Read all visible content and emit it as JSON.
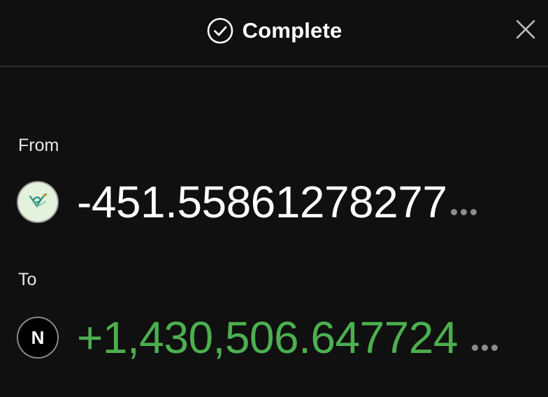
{
  "header": {
    "title": "Complete",
    "status_icon": "check-circle-icon",
    "close_icon": "close-icon"
  },
  "from": {
    "label": "From",
    "amount": "-451.55861278277",
    "token_icon": "leaf-token-icon",
    "amount_color": "#ffffff"
  },
  "to": {
    "label": "To",
    "amount": "+1,430,506.647724",
    "token_letter": "N",
    "token_icon": "n-token-icon",
    "amount_color": "#4caf50"
  },
  "colors": {
    "background": "#101010",
    "divider": "#2e2e2e",
    "positive": "#4caf50",
    "muted": "#8c8c8c"
  }
}
